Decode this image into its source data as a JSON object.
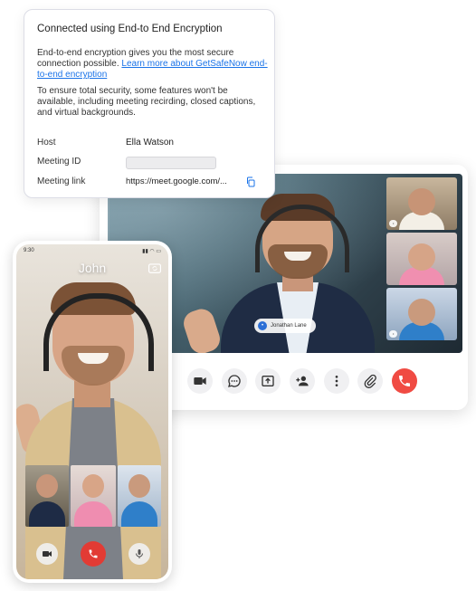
{
  "popup": {
    "title": "Connected using End-to End Encryption",
    "para1_text": "End-to-end encryption gives you the most secure connection possible. ",
    "para1_link": "Learn more about GetSafeNow end-to-end encryption",
    "para2": "To ensure total security, some features won't be available, including meeting recirding, closed captions, and virtual backgrounds.",
    "host_label": "Host",
    "host_value": "Ella Watson",
    "meeting_id_label": "Meeting ID",
    "meeting_id_value": "",
    "meeting_link_label": "Meeting link",
    "meeting_link_value": "https://meet.google.com/..."
  },
  "desktop": {
    "speaker_name": "Jonathan Lane",
    "toolbar_icons": [
      "camera-icon",
      "chat-icon",
      "share-screen-icon",
      "add-person-icon",
      "more-icon",
      "attach-icon",
      "end-call-icon"
    ],
    "end_call_color": "#f04b43"
  },
  "phone": {
    "status_time": "9:30",
    "caller_name": "John",
    "end_call_color": "#e23b34"
  }
}
